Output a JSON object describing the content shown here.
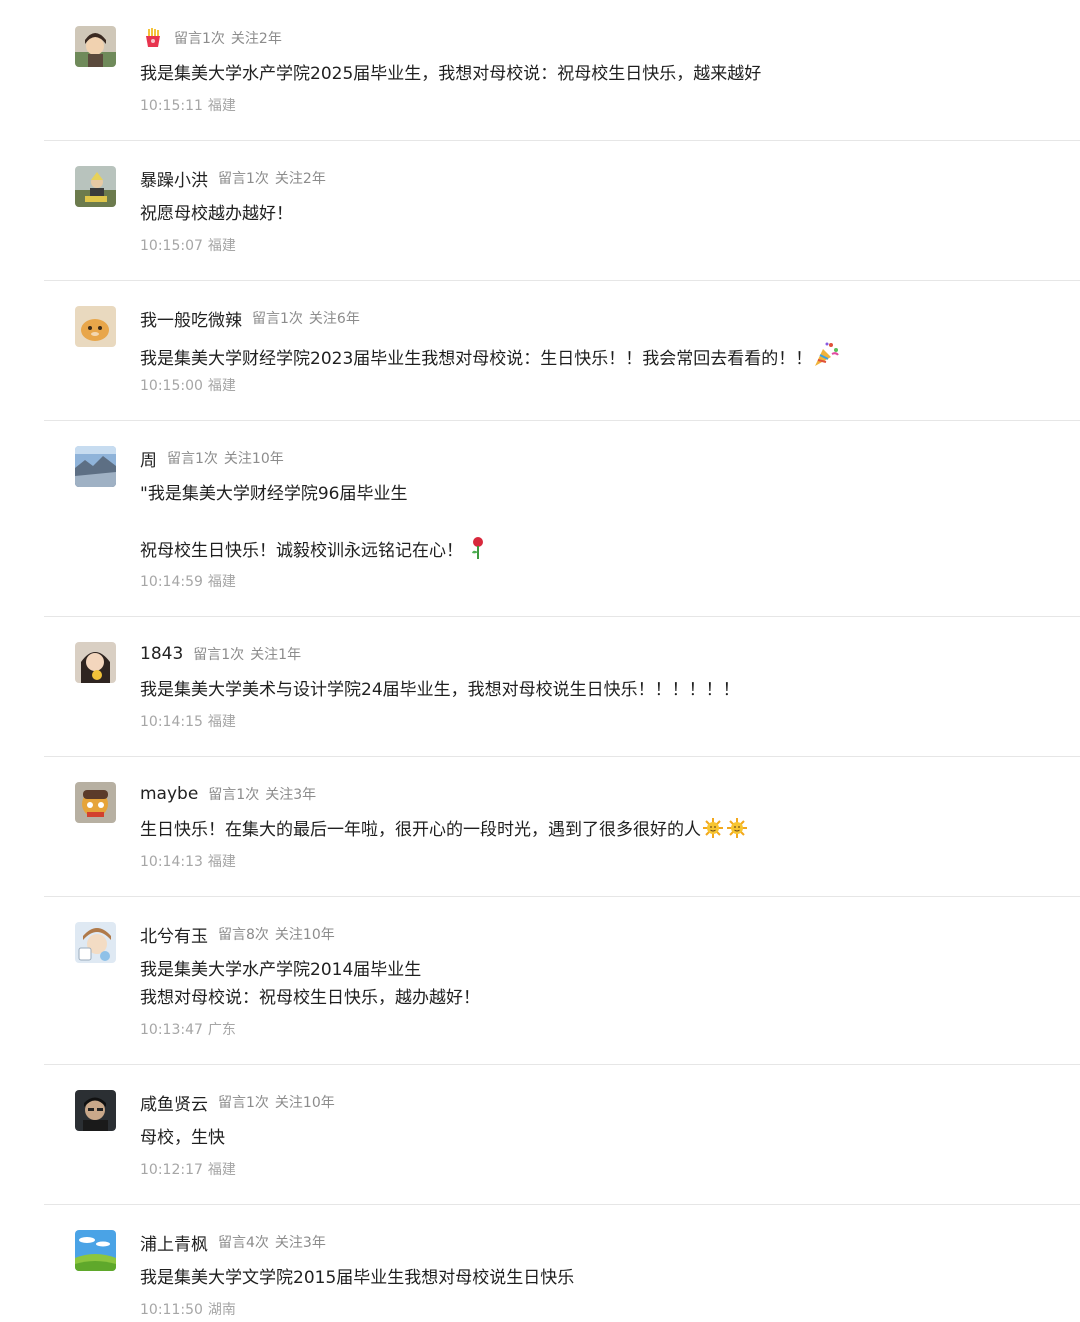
{
  "comments": [
    {
      "nickname": "",
      "badge_icon": "fries-icon",
      "msg_count": "留言1次",
      "follow": "关注2年",
      "lines": [
        "我是集美大学水产学院2025届毕业生，我想对母校说：祝母校生日快乐，越来越好"
      ],
      "time": "10:15:11",
      "location": "福建"
    },
    {
      "nickname": "暴躁小洪",
      "msg_count": "留言1次",
      "follow": "关注2年",
      "lines": [
        "祝愿母校越办越好！"
      ],
      "time": "10:15:07",
      "location": "福建"
    },
    {
      "nickname": "我一般吃微辣",
      "msg_count": "留言1次",
      "follow": "关注6年",
      "lines": [
        "我是集美大学财经学院2023届毕业生我想对母校说：生日快乐！！我会常回去看看的！！"
      ],
      "emoji": "party-popper-icon",
      "time": "10:15:00",
      "location": "福建"
    },
    {
      "nickname": "周",
      "msg_count": "留言1次",
      "follow": "关注10年",
      "lines": [
        "\"我是集美大学财经学院96届毕业生",
        "",
        "祝母校生日快乐！诚毅校训永远铭记在心！"
      ],
      "emoji": "rose-icon",
      "time": "10:14:59",
      "location": "福建"
    },
    {
      "nickname": "1843",
      "msg_count": "留言1次",
      "follow": "关注1年",
      "lines": [
        "我是集美大学美术与设计学院24届毕业生，我想对母校说生日快乐！！！！！！"
      ],
      "time": "10:14:15",
      "location": "福建"
    },
    {
      "nickname": "maybe",
      "msg_count": "留言1次",
      "follow": "关注3年",
      "lines": [
        "生日快乐！在集大的最后一年啦，很开心的一段时光，遇到了很多很好的人"
      ],
      "emoji": "sun-icon",
      "time": "10:14:13",
      "location": "福建"
    },
    {
      "nickname": "北兮有玉",
      "msg_count": "留言8次",
      "follow": "关注10年",
      "lines": [
        "我是集美大学水产学院2014届毕业生",
        "我想对母校说：祝母校生日快乐，越办越好！"
      ],
      "time": "10:13:47",
      "location": "广东"
    },
    {
      "nickname": "咸鱼贤云",
      "msg_count": "留言1次",
      "follow": "关注10年",
      "lines": [
        "母校，生快"
      ],
      "time": "10:12:17",
      "location": "福建"
    },
    {
      "nickname": "浦上青枫",
      "msg_count": "留言4次",
      "follow": "关注3年",
      "lines": [
        "我是集美大学文学院2015届毕业生我想对母校说生日快乐"
      ],
      "time": "10:11:50",
      "location": "湖南"
    }
  ]
}
